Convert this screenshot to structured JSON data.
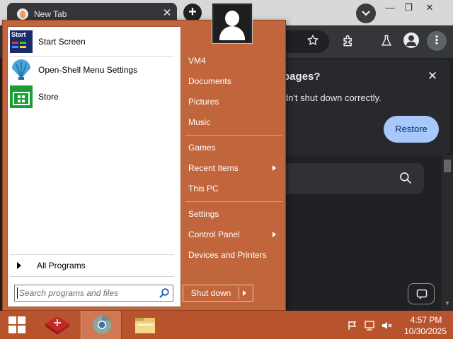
{
  "browser": {
    "tab_title": "New Tab",
    "tab_close": "✕",
    "new_tab": "+",
    "window_controls": {
      "minimize": "—",
      "maximize": "❐",
      "close": "✕"
    },
    "menu_glyph": "⋮",
    "restore_bubble": {
      "title": "Restore pages?",
      "message": "Chrome didn't shut down correctly.",
      "close": "✕",
      "button": "Restore"
    },
    "colors": {
      "accent_button": "#a8c7fa",
      "background": "#202124"
    }
  },
  "start_menu": {
    "pinned": [
      {
        "label": "Start Screen",
        "icon": "start-screen-icon"
      },
      {
        "label": "Open-Shell Menu Settings",
        "icon": "open-shell-icon"
      },
      {
        "label": "Store",
        "icon": "store-icon"
      }
    ],
    "start_icon_text": "Start",
    "all_programs": "All Programs",
    "search_placeholder": "Search programs and files",
    "right_items": [
      {
        "label": "VM4"
      },
      {
        "label": "Documents"
      },
      {
        "label": "Pictures"
      },
      {
        "label": "Music"
      },
      {
        "label": "Games"
      },
      {
        "label": "Recent Items",
        "submenu": true
      },
      {
        "label": "This PC"
      },
      {
        "label": "Settings"
      },
      {
        "label": "Control Panel",
        "submenu": true
      },
      {
        "label": "Devices and Printers"
      }
    ],
    "shutdown": "Shut down",
    "colors": {
      "menu_bg": "#c1663c",
      "taskbar": "#b7542d"
    }
  },
  "taskbar": {
    "apps": [
      {
        "name": "app-icon"
      },
      {
        "name": "chrome-icon"
      },
      {
        "name": "file-explorer-icon"
      }
    ],
    "tray_icons": [
      "action-center-flag-icon",
      "network-icon",
      "volume-muted-icon"
    ],
    "time": "4:57 PM",
    "date": "10/30/2025"
  }
}
